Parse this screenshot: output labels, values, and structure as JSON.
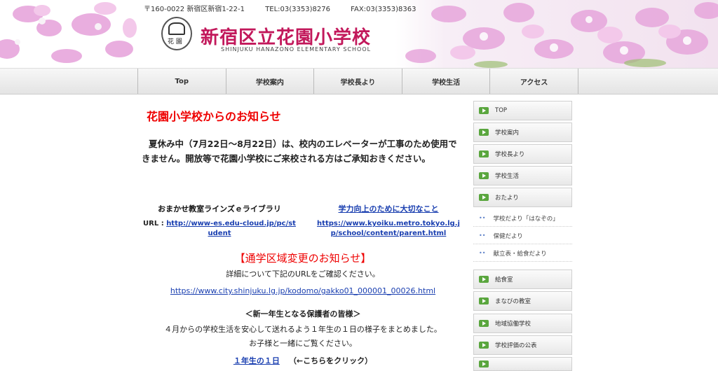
{
  "header": {
    "address": "〒160-0022 新宿区新宿1-22-1",
    "tel": "TEL:03(3353)8276",
    "fax": "FAX:03(3353)8363",
    "school_name": "新宿区立花園小学校",
    "school_name_en": "SHINJUKU HANAZONO ELEMENTARY SCHOOL",
    "logo_text": "花 園"
  },
  "nav": {
    "items": [
      "Top",
      "学校案内",
      "学校長より",
      "学校生活",
      "アクセス"
    ]
  },
  "main": {
    "news_title": "花園小学校からのお知らせ",
    "notice": "夏休み中（7月22日〜8月22日）は、校内のエレベーターが工事のため使用できません。開放等で花園小学校にご来校される方はご承知おきください。",
    "link1": {
      "heading": "おまかせ教室ラインズｅライブラリ",
      "prefix": "URL : ",
      "url": "http://www-es.edu-cloud.jp/pc/student"
    },
    "link2": {
      "heading": "学力向上のために大切なこと",
      "url": "https://www.kyoiku.metro.tokyo.lg.jp/school/content/parent.html"
    },
    "district": {
      "heading": "【通学区域変更のお知らせ】",
      "text": "詳細について下記のURLをご確認ください。",
      "url": "https://www.city.shinjuku.lg.jp/kodomo/gakko01_000001_00026.html"
    },
    "first_grade": {
      "heading": "＜新一年生となる保護者の皆様＞",
      "line1": "４月からの学校生活を安心して送れるよう１年生の１日の様子をまとめました。",
      "line2": "お子様と一緒にご覧ください。",
      "link": "１年生の１日",
      "after": "（←こちらをクリック）"
    }
  },
  "sidebar": {
    "top_items": [
      "TOP",
      "学校案内",
      "学校長より",
      "学校生活",
      "おたより"
    ],
    "sub_items": [
      "学校だより「はなぞの」",
      "保健だより",
      "献立表・給食だより"
    ],
    "bottom_items": [
      "給食室",
      "まなびの教室",
      "地域協働学校",
      "学校評価の公表"
    ]
  },
  "colors": {
    "title_pink": "#c2185b",
    "news_red": "#ee0000",
    "link_blue": "#1a3fb0",
    "arrow_green": "#5aa63e"
  }
}
